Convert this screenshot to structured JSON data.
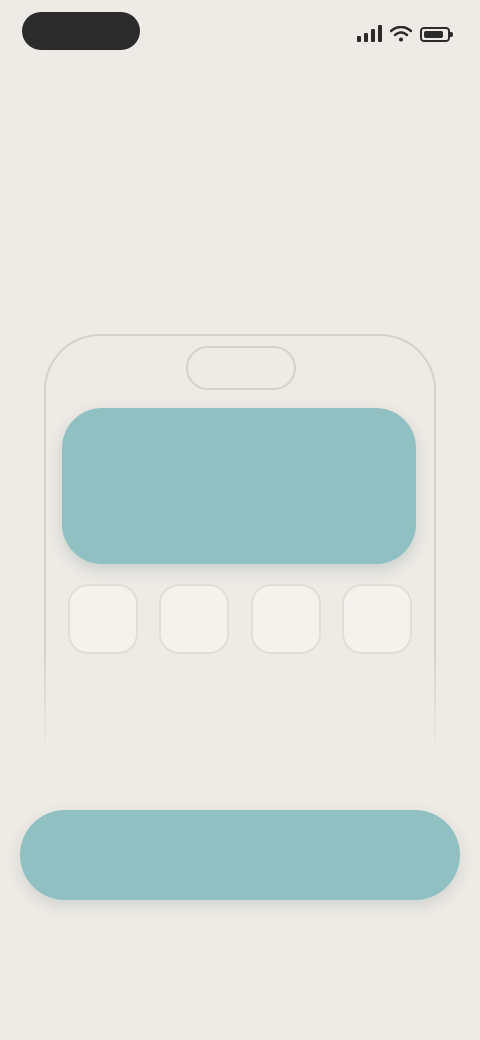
{
  "status_bar": {
    "time": "",
    "battery_level": 0.85,
    "icons": [
      "cellular-signal-icon",
      "wifi-icon",
      "battery-icon"
    ]
  },
  "onboarding": {
    "title": "",
    "subtitle": ""
  },
  "illustration": {
    "widget_line_1": "",
    "widget_line_2": "",
    "app_icon_count": 4
  },
  "actions": {
    "primary_label": "",
    "secondary_label": ""
  },
  "colors": {
    "background": "#EEEAE5",
    "accent": "#91C0C2",
    "text": "#2C2C2C"
  }
}
